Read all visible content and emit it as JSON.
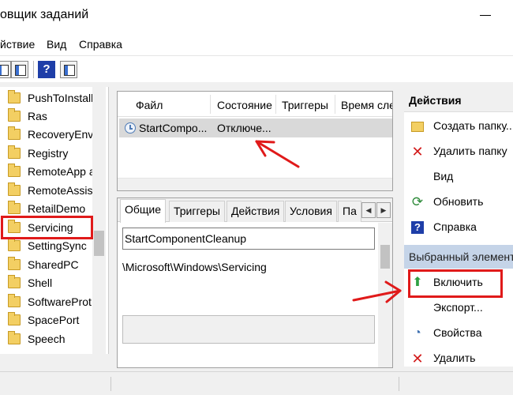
{
  "window": {
    "title": "овщик заданий"
  },
  "menu": {
    "items": [
      "йствие",
      "Вид",
      "Справка"
    ]
  },
  "tree": {
    "items": [
      {
        "label": "PushToInstall"
      },
      {
        "label": "Ras"
      },
      {
        "label": "RecoveryEnvi"
      },
      {
        "label": "Registry"
      },
      {
        "label": "RemoteApp a"
      },
      {
        "label": "RemoteAssist"
      },
      {
        "label": "RetailDemo"
      },
      {
        "label": "Servicing"
      },
      {
        "label": "SettingSync"
      },
      {
        "label": "SharedPC"
      },
      {
        "label": "Shell"
      },
      {
        "label": "SoftwareProt"
      },
      {
        "label": "SpacePort"
      },
      {
        "label": "Speech"
      }
    ],
    "selected": "Servicing"
  },
  "task_list": {
    "columns": [
      "Файл",
      "Состояние",
      "Триггеры",
      "Время сле"
    ],
    "rows": [
      {
        "name": "StartCompo...",
        "state": "Отключе..."
      }
    ]
  },
  "details": {
    "tabs": [
      "Общие",
      "Триггеры",
      "Действия",
      "Условия",
      "Па"
    ],
    "active_tab": "Общие",
    "name_value": "StartComponentCleanup",
    "path": "\\Microsoft\\Windows\\Servicing"
  },
  "actions": {
    "header": "Действия",
    "items": [
      {
        "label": "Создать папку...",
        "icon": "new-folder-icon"
      },
      {
        "label": "Удалить папку",
        "icon": "delete-icon"
      },
      {
        "label": "Вид",
        "icon": ""
      },
      {
        "label": "Обновить",
        "icon": "refresh-icon"
      },
      {
        "label": "Справка",
        "icon": "help-icon"
      }
    ],
    "selected_header": "Выбранный элемент",
    "selected_items": [
      {
        "label": "Включить",
        "icon": "enable-arrow-icon"
      },
      {
        "label": "Экспорт...",
        "icon": ""
      },
      {
        "label": "Свойства",
        "icon": "properties-icon"
      },
      {
        "label": "Удалить",
        "icon": "delete-icon"
      }
    ]
  },
  "colors": {
    "highlight_red": "#e01a1a",
    "selected_header_bg": "#c5d4e8",
    "row_selected_bg": "#d9d9d9"
  }
}
